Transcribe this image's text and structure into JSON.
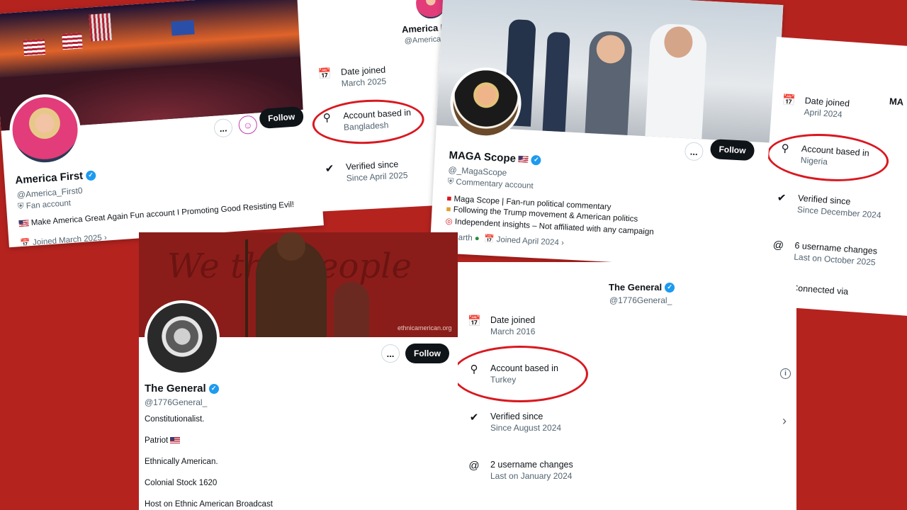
{
  "card1": {
    "name": "America First",
    "handle": "@America_First0",
    "label": "Fan account",
    "bio": "Make America Great Again Fun account I Promoting Good Resisting Evil!",
    "joined": "Joined March 2025",
    "follow": "Follow",
    "more": "..."
  },
  "panel1": {
    "name": "America First",
    "handle": "@America_F",
    "date_title": "Date joined",
    "date_value": "March 2025",
    "loc_title": "Account based in",
    "loc_value": "Bangladesh",
    "ver_title": "Verified since",
    "ver_value": "Since April 2025"
  },
  "card2": {
    "name": "MAGA Scope",
    "handle": "@_MagaScope",
    "label": "Commentary account",
    "bio1": "Maga Scope | Fan-run political commentary",
    "bio2": "Following the Trump movement & American politics",
    "bio3": "Independent insights – Not affiliated with any campaign",
    "location": "Earth",
    "joined": "Joined April 2024",
    "follow": "Follow",
    "more": "..."
  },
  "panel2": {
    "name_fragment": "MA",
    "date_title": "Date joined",
    "date_value": "April 2024",
    "loc_title": "Account based in",
    "loc_value": "Nigeria",
    "ver_title": "Verified since",
    "ver_value": "Since December 2024",
    "user_title": "6 username changes",
    "user_value": "Last on October 2025",
    "conn_title": "Connected via"
  },
  "card3": {
    "name": "The General",
    "handle": "@1776General_",
    "bio1": "Constitutionalist.",
    "bio2": "Patriot",
    "bio3": "Ethnically American.",
    "bio4": "Colonial Stock 1620",
    "bio5": "Host on Ethnic American Broadcast",
    "banner_text": "We the People",
    "banner_url": "ethnicamerican.org",
    "follow": "Follow",
    "more": "..."
  },
  "panel3": {
    "name": "The General",
    "handle": "@1776General_",
    "date_title": "Date joined",
    "date_value": "March 2016",
    "loc_title": "Account based in",
    "loc_value": "Turkey",
    "ver_title": "Verified since",
    "ver_value": "Since August 2024",
    "user_title": "2 username changes",
    "user_value": "Last on January 2024"
  },
  "colors": {
    "background": "#b5231f",
    "highlight_ring": "#d9181f",
    "verified": "#1d9bf0"
  },
  "icons": [
    "calendar-icon",
    "location-pin-icon",
    "verified-badge-icon",
    "at-sign-icon",
    "info-icon",
    "chevron-right-icon",
    "more-dots-icon",
    "globe-icon"
  ]
}
